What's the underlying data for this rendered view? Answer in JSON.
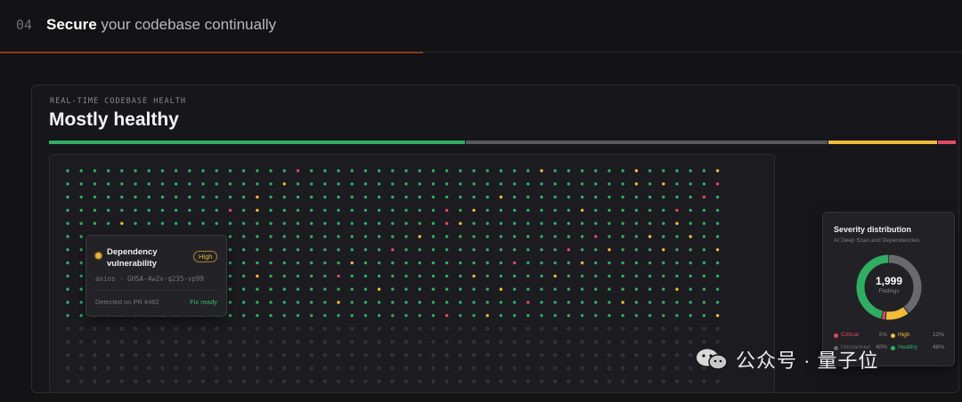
{
  "section": {
    "step_number": "04",
    "title_bold": "Secure",
    "title_rest": " your codebase continually",
    "progress_fraction": 0.44
  },
  "panel": {
    "kicker": "REAL-TIME CODEBASE HEALTH",
    "headline": "Mostly healthy",
    "health_bar": [
      {
        "status": "healthy",
        "fraction": 0.46,
        "color": "#2fae63"
      },
      {
        "status": "unscanned",
        "fraction": 0.4,
        "color": "#59585d"
      },
      {
        "status": "high",
        "fraction": 0.12,
        "color": "#f0bc3a"
      },
      {
        "status": "critical",
        "fraction": 0.02,
        "color": "#e24a64"
      }
    ]
  },
  "dot_grid": {
    "columns": 49,
    "scanned_rows": 12,
    "unscanned_rows": 6,
    "colors": {
      "healthy": "#2fae63",
      "high": "#f0bc3a",
      "critical": "#e24a64",
      "unscanned": "#48474c"
    }
  },
  "tooltip": {
    "title": "Dependency vulnerability",
    "severity_badge": "High",
    "package": "axios · GHSA-4w2v-q235-vp99",
    "detected": "Detected on PR #482",
    "action": "Fix ready",
    "dot_color": "#e8b53a"
  },
  "severity": {
    "title": "Severity distribution",
    "subtitle": "AI Deep Scan and Dependencies",
    "total": "1,999",
    "total_label": "Findings",
    "legend": [
      {
        "name": "Critical",
        "percent": "2%",
        "value": 2,
        "color": "#e24a64"
      },
      {
        "name": "High",
        "percent": "12%",
        "value": 12,
        "color": "#f0bc3a"
      },
      {
        "name": "Unscanned",
        "percent": "40%",
        "value": 40,
        "color": "#6a696e"
      },
      {
        "name": "Healthy",
        "percent": "46%",
        "value": 46,
        "color": "#2fae63"
      }
    ]
  },
  "watermark": {
    "text": "公众号 · 量子位",
    "icon": "wechat-icon"
  }
}
